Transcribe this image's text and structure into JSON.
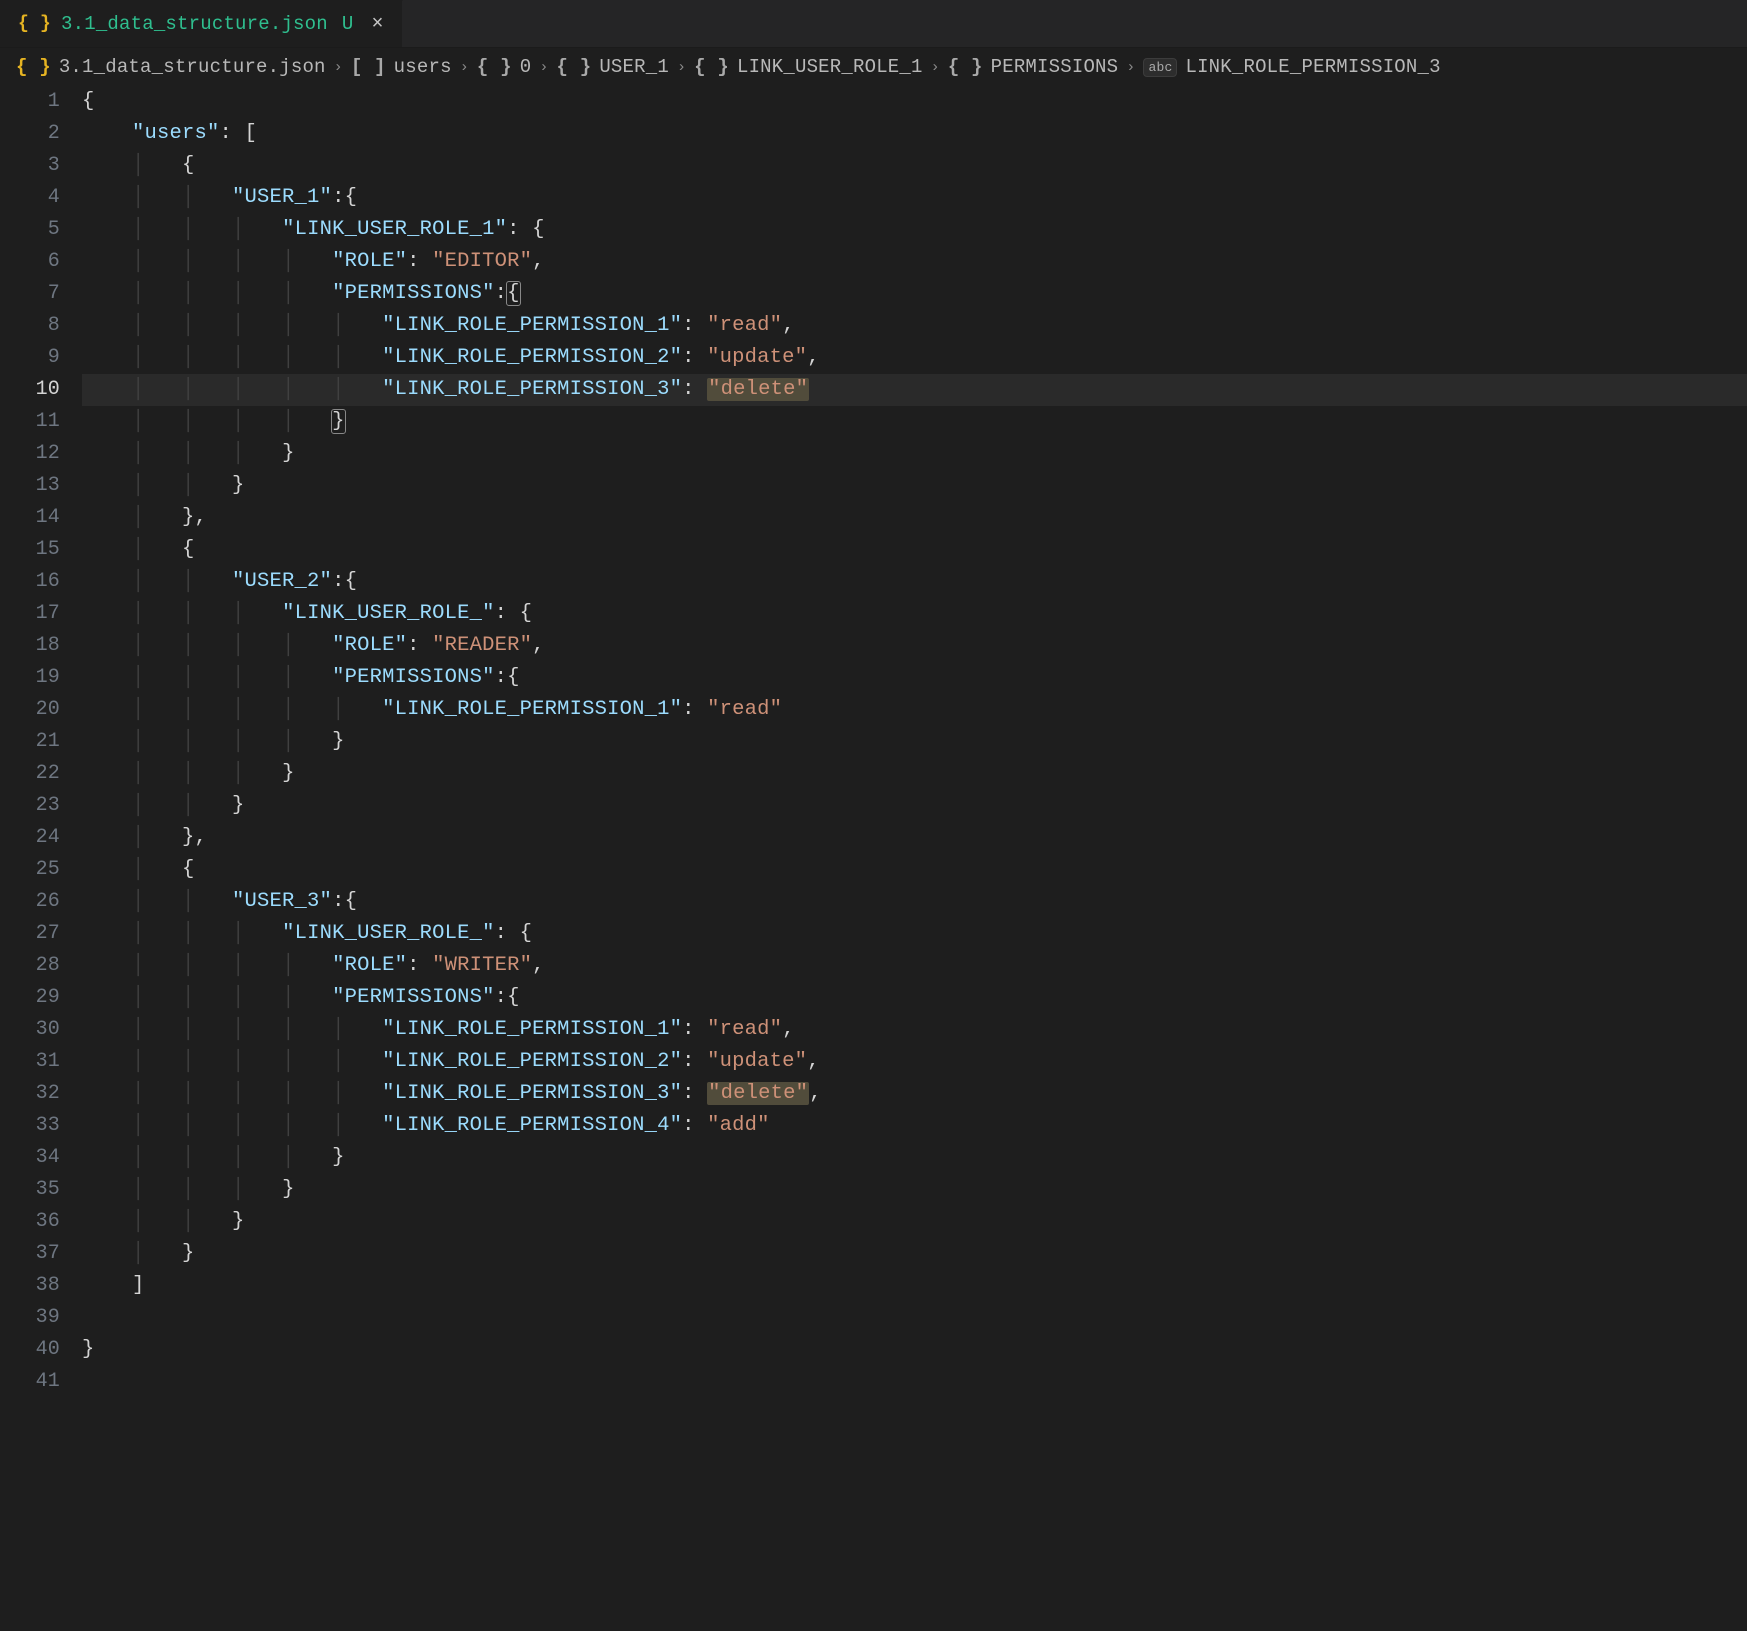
{
  "tab": {
    "file_icon": "{ }",
    "file_name": "3.1_data_structure.json",
    "modified_badge": "U",
    "close_glyph": "×"
  },
  "breadcrumb": {
    "file_icon": "{ }",
    "file_name": "3.1_data_structure.json",
    "sep": "›",
    "segments": [
      {
        "icon_kind": "array",
        "icon": "[ ]",
        "label": "users"
      },
      {
        "icon_kind": "obj",
        "icon": "{ }",
        "label": "0"
      },
      {
        "icon_kind": "obj",
        "icon": "{ }",
        "label": "USER_1"
      },
      {
        "icon_kind": "obj",
        "icon": "{ }",
        "label": "LINK_USER_ROLE_1"
      },
      {
        "icon_kind": "obj",
        "icon": "{ }",
        "label": "PERMISSIONS"
      },
      {
        "icon_kind": "str",
        "icon": "abc",
        "label": "LINK_ROLE_PERMISSION_3"
      }
    ]
  },
  "active_line": 10,
  "lines": {
    "1": {
      "indent": 0,
      "tokens": [
        {
          "t": "punc",
          "v": "{"
        }
      ]
    },
    "2": {
      "indent": 1,
      "tokens": [
        {
          "t": "key",
          "v": "\"users\""
        },
        {
          "t": "punc",
          "v": ": ["
        }
      ]
    },
    "3": {
      "indent": 2,
      "tokens": [
        {
          "t": "punc",
          "v": "{"
        }
      ]
    },
    "4": {
      "indent": 3,
      "tokens": [
        {
          "t": "key",
          "v": "\"USER_1\""
        },
        {
          "t": "punc",
          "v": ":{"
        }
      ]
    },
    "5": {
      "indent": 4,
      "tokens": [
        {
          "t": "key",
          "v": "\"LINK_USER_ROLE_1\""
        },
        {
          "t": "punc",
          "v": ": {"
        }
      ]
    },
    "6": {
      "indent": 5,
      "tokens": [
        {
          "t": "key",
          "v": "\"ROLE\""
        },
        {
          "t": "punc",
          "v": ": "
        },
        {
          "t": "str",
          "v": "\"EDITOR\""
        },
        {
          "t": "punc",
          "v": ","
        }
      ]
    },
    "7": {
      "indent": 5,
      "tokens": [
        {
          "t": "key",
          "v": "\"PERMISSIONS\""
        },
        {
          "t": "punc",
          "v": ":"
        },
        {
          "t": "brhl",
          "v": "{"
        }
      ]
    },
    "8": {
      "indent": 6,
      "tokens": [
        {
          "t": "key",
          "v": "\"LINK_ROLE_PERMISSION_1\""
        },
        {
          "t": "punc",
          "v": ": "
        },
        {
          "t": "str",
          "v": "\"read\""
        },
        {
          "t": "punc",
          "v": ","
        }
      ]
    },
    "9": {
      "indent": 6,
      "tokens": [
        {
          "t": "key",
          "v": "\"LINK_ROLE_PERMISSION_2\""
        },
        {
          "t": "punc",
          "v": ": "
        },
        {
          "t": "str",
          "v": "\"update\""
        },
        {
          "t": "punc",
          "v": ","
        }
      ]
    },
    "10": {
      "indent": 6,
      "tokens": [
        {
          "t": "key",
          "v": "\"LINK_ROLE_PERMISSION_3\""
        },
        {
          "t": "punc",
          "v": ": "
        },
        {
          "t": "strhl",
          "v": "\"delete\""
        }
      ]
    },
    "11": {
      "indent": 5,
      "tokens": [
        {
          "t": "brhl",
          "v": "}"
        }
      ]
    },
    "12": {
      "indent": 4,
      "tokens": [
        {
          "t": "punc",
          "v": "}"
        }
      ]
    },
    "13": {
      "indent": 3,
      "tokens": [
        {
          "t": "punc",
          "v": "}"
        }
      ]
    },
    "14": {
      "indent": 2,
      "tokens": [
        {
          "t": "punc",
          "v": "},"
        }
      ]
    },
    "15": {
      "indent": 2,
      "tokens": [
        {
          "t": "punc",
          "v": "{"
        }
      ]
    },
    "16": {
      "indent": 3,
      "tokens": [
        {
          "t": "key",
          "v": "\"USER_2\""
        },
        {
          "t": "punc",
          "v": ":{"
        }
      ]
    },
    "17": {
      "indent": 4,
      "tokens": [
        {
          "t": "key",
          "v": "\"LINK_USER_ROLE_\""
        },
        {
          "t": "punc",
          "v": ": {"
        }
      ]
    },
    "18": {
      "indent": 5,
      "tokens": [
        {
          "t": "key",
          "v": "\"ROLE\""
        },
        {
          "t": "punc",
          "v": ": "
        },
        {
          "t": "str",
          "v": "\"READER\""
        },
        {
          "t": "punc",
          "v": ","
        }
      ]
    },
    "19": {
      "indent": 5,
      "tokens": [
        {
          "t": "key",
          "v": "\"PERMISSIONS\""
        },
        {
          "t": "punc",
          "v": ":{"
        }
      ]
    },
    "20": {
      "indent": 6,
      "tokens": [
        {
          "t": "key",
          "v": "\"LINK_ROLE_PERMISSION_1\""
        },
        {
          "t": "punc",
          "v": ": "
        },
        {
          "t": "str",
          "v": "\"read\""
        }
      ]
    },
    "21": {
      "indent": 5,
      "tokens": [
        {
          "t": "punc",
          "v": "}"
        }
      ]
    },
    "22": {
      "indent": 4,
      "tokens": [
        {
          "t": "punc",
          "v": "}"
        }
      ]
    },
    "23": {
      "indent": 3,
      "tokens": [
        {
          "t": "punc",
          "v": "}"
        }
      ]
    },
    "24": {
      "indent": 2,
      "tokens": [
        {
          "t": "punc",
          "v": "},"
        }
      ]
    },
    "25": {
      "indent": 2,
      "tokens": [
        {
          "t": "punc",
          "v": "{"
        }
      ]
    },
    "26": {
      "indent": 3,
      "tokens": [
        {
          "t": "key",
          "v": "\"USER_3\""
        },
        {
          "t": "punc",
          "v": ":{"
        }
      ]
    },
    "27": {
      "indent": 4,
      "tokens": [
        {
          "t": "key",
          "v": "\"LINK_USER_ROLE_\""
        },
        {
          "t": "punc",
          "v": ": {"
        }
      ]
    },
    "28": {
      "indent": 5,
      "tokens": [
        {
          "t": "key",
          "v": "\"ROLE\""
        },
        {
          "t": "punc",
          "v": ": "
        },
        {
          "t": "str",
          "v": "\"WRITER\""
        },
        {
          "t": "punc",
          "v": ","
        }
      ]
    },
    "29": {
      "indent": 5,
      "tokens": [
        {
          "t": "key",
          "v": "\"PERMISSIONS\""
        },
        {
          "t": "punc",
          "v": ":{"
        }
      ]
    },
    "30": {
      "indent": 6,
      "tokens": [
        {
          "t": "key",
          "v": "\"LINK_ROLE_PERMISSION_1\""
        },
        {
          "t": "punc",
          "v": ": "
        },
        {
          "t": "str",
          "v": "\"read\""
        },
        {
          "t": "punc",
          "v": ","
        }
      ]
    },
    "31": {
      "indent": 6,
      "tokens": [
        {
          "t": "key",
          "v": "\"LINK_ROLE_PERMISSION_2\""
        },
        {
          "t": "punc",
          "v": ": "
        },
        {
          "t": "str",
          "v": "\"update\""
        },
        {
          "t": "punc",
          "v": ","
        }
      ]
    },
    "32": {
      "indent": 6,
      "tokens": [
        {
          "t": "key",
          "v": "\"LINK_ROLE_PERMISSION_3\""
        },
        {
          "t": "punc",
          "v": ": "
        },
        {
          "t": "strhl",
          "v": "\"delete\""
        },
        {
          "t": "punc",
          "v": ","
        }
      ]
    },
    "33": {
      "indent": 6,
      "tokens": [
        {
          "t": "key",
          "v": "\"LINK_ROLE_PERMISSION_4\""
        },
        {
          "t": "punc",
          "v": ": "
        },
        {
          "t": "str",
          "v": "\"add\""
        }
      ]
    },
    "34": {
      "indent": 5,
      "tokens": [
        {
          "t": "punc",
          "v": "}"
        }
      ]
    },
    "35": {
      "indent": 4,
      "tokens": [
        {
          "t": "punc",
          "v": "}"
        }
      ]
    },
    "36": {
      "indent": 3,
      "tokens": [
        {
          "t": "punc",
          "v": "}"
        }
      ]
    },
    "37": {
      "indent": 2,
      "tokens": [
        {
          "t": "punc",
          "v": "}"
        }
      ]
    },
    "38": {
      "indent": 1,
      "tokens": [
        {
          "t": "punc",
          "v": "]"
        }
      ]
    },
    "39": {
      "indent": 0,
      "tokens": []
    },
    "40": {
      "indent": 0,
      "tokens": [
        {
          "t": "punc",
          "v": "}"
        }
      ]
    },
    "41": {
      "indent": 0,
      "tokens": []
    }
  }
}
